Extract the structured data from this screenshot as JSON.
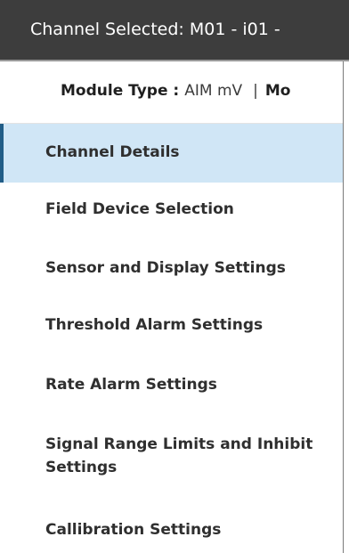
{
  "header": {
    "title": "Channel Selected: M01 - i01 -"
  },
  "module": {
    "label": "Module Type :",
    "value": "AIM mV",
    "separator": "|",
    "next_label": "Mo"
  },
  "menu": {
    "items": [
      {
        "label": "Channel Details"
      },
      {
        "label": "Field Device Selection"
      },
      {
        "label": "Sensor and Display Settings"
      },
      {
        "label": "Threshold Alarm Settings"
      },
      {
        "label": "Rate Alarm Settings"
      },
      {
        "label": "Signal Range Limits and Inhibit Settings"
      },
      {
        "label": "Callibration Settings"
      }
    ],
    "active_index": 0
  },
  "colors": {
    "titlebar_bg": "#3d3d3d",
    "active_bg": "#d0e6f6",
    "active_accent": "#215d87"
  }
}
